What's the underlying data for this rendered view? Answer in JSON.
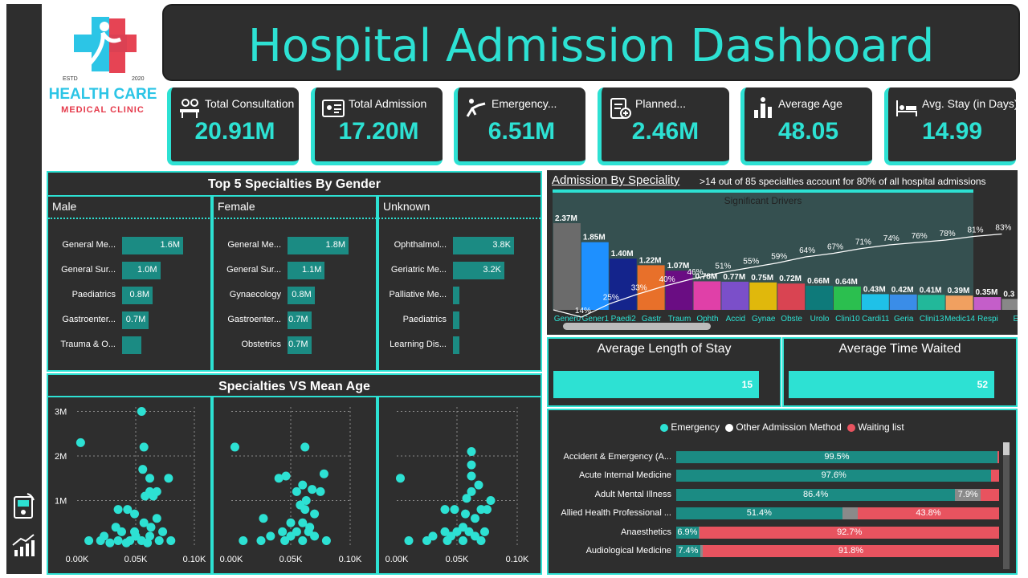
{
  "logo": {
    "estd": "ESTD",
    "year": "2020",
    "name": "HEALTH CARE",
    "sub": "MEDICAL CLINIC"
  },
  "title": "Hospital Admission Dashboard",
  "kpis": [
    {
      "label": "Total Consultation",
      "value": "20.91M",
      "icon": "consultation-icon"
    },
    {
      "label": "Total Admission",
      "value": "17.20M",
      "icon": "id-card-icon"
    },
    {
      "label": "Emergency...",
      "value": "6.51M",
      "icon": "emergency-icon"
    },
    {
      "label": "Planned...",
      "value": "2.46M",
      "icon": "clipboard-icon"
    },
    {
      "label": "Average Age",
      "value": "48.05",
      "icon": "bar-people-icon"
    },
    {
      "label": "Avg. Stay (in Days)",
      "value": "14.99",
      "icon": "bed-icon"
    }
  ],
  "gender_panel": {
    "title": "Top 5 Specialties By Gender",
    "groups": [
      {
        "name": "Male",
        "items": [
          {
            "label": "General Me...",
            "display": "1.6M",
            "value": 1.6
          },
          {
            "label": "General Sur...",
            "display": "1.0M",
            "value": 1.0
          },
          {
            "label": "Paediatrics",
            "display": "0.8M",
            "value": 0.8
          },
          {
            "label": "Gastroenter...",
            "display": "0.7M",
            "value": 0.7
          },
          {
            "label": "Trauma & O...",
            "display": "",
            "value": 0.5
          }
        ]
      },
      {
        "name": "Female",
        "items": [
          {
            "label": "General Me...",
            "display": "1.8M",
            "value": 1.8
          },
          {
            "label": "General Sur...",
            "display": "1.1M",
            "value": 1.1
          },
          {
            "label": "Gynaecology",
            "display": "0.8M",
            "value": 0.8
          },
          {
            "label": "Gastroenter...",
            "display": "0.7M",
            "value": 0.7
          },
          {
            "label": "Obstetrics",
            "display": "0.7M",
            "value": 0.7
          }
        ]
      },
      {
        "name": "Unknown",
        "items": [
          {
            "label": "Ophthalmol...",
            "display": "3.8K",
            "value": 3.8
          },
          {
            "label": "Geriatric Me...",
            "display": "3.2K",
            "value": 3.2
          },
          {
            "label": "Palliative Me...",
            "display": "",
            "value": 0.4
          },
          {
            "label": "Paediatrics",
            "display": "",
            "value": 0.4
          },
          {
            "label": "Learning Dis...",
            "display": "",
            "value": 0.4
          }
        ]
      }
    ]
  },
  "scatter_panel": {
    "title": "Specialties VS Mean Age",
    "y_ticks": [
      "3M",
      "2M",
      "1M"
    ],
    "x_ticks": [
      "0.00K",
      "0.05K",
      "0.10K"
    ]
  },
  "pareto": {
    "title": "Admission By Speciality",
    "note": ">14 out of 85 specialties account for 80% of all hospital admissions",
    "band_label": "Significant Drivers"
  },
  "avg_los": {
    "title": "Average Length of Stay",
    "value": "15",
    "fraction": 1.0
  },
  "avg_wait": {
    "title": "Average Time Waited",
    "value": "52",
    "fraction": 1.0
  },
  "method": {
    "legend": [
      {
        "label": "Emergency",
        "color": "#2de1d3"
      },
      {
        "label": "Other Admission Method",
        "color": "#ffffff"
      },
      {
        "label": "Waiting list",
        "color": "#e8535f"
      }
    ],
    "rows": [
      {
        "label": "Accident & Emergency (A...",
        "emergency": 99.5,
        "other": 0.0,
        "waiting": 0.5,
        "e_lbl": "99.5%",
        "o_lbl": "",
        "w_lbl": ""
      },
      {
        "label": "Acute Internal Medicine",
        "emergency": 97.6,
        "other": 0.0,
        "waiting": 2.4,
        "e_lbl": "97.6%",
        "o_lbl": "",
        "w_lbl": ""
      },
      {
        "label": "Adult Mental Illness",
        "emergency": 86.4,
        "other": 7.9,
        "waiting": 5.7,
        "e_lbl": "86.4%",
        "o_lbl": "7.9%",
        "w_lbl": ""
      },
      {
        "label": "Allied Health Professional ...",
        "emergency": 51.4,
        "other": 4.8,
        "waiting": 43.8,
        "e_lbl": "51.4%",
        "o_lbl": "",
        "w_lbl": "43.8%"
      },
      {
        "label": "Anaesthetics",
        "emergency": 6.9,
        "other": 0.4,
        "waiting": 92.7,
        "e_lbl": "6.9%",
        "o_lbl": "",
        "w_lbl": "92.7%"
      },
      {
        "label": "Audiological Medicine",
        "emergency": 7.4,
        "other": 0.8,
        "waiting": 91.8,
        "e_lbl": "7.4%",
        "o_lbl": "",
        "w_lbl": "91.8%"
      }
    ]
  },
  "chart_data": [
    {
      "type": "bar",
      "title": "Admission By Speciality",
      "categories": [
        "Gener0",
        "Gener1",
        "Paedi2",
        "Gastr",
        "Traum",
        "Ophth",
        "Accid",
        "Gynae",
        "Obste",
        "Urolo",
        "Clini10",
        "Cardi11",
        "Geria",
        "Clini13",
        "Medic14",
        "Respi",
        "E"
      ],
      "values": [
        2.37,
        1.85,
        1.4,
        1.22,
        1.07,
        0.78,
        0.77,
        0.75,
        0.72,
        0.66,
        0.64,
        0.43,
        0.42,
        0.41,
        0.39,
        0.35,
        0.3
      ],
      "value_labels": [
        "2.37M",
        "1.85M",
        "1.40M",
        "1.22M",
        "1.07M",
        "0.78M",
        "0.77M",
        "0.75M",
        "0.72M",
        "0.66M",
        "0.64M",
        "0.43M",
        "0.42M",
        "0.41M",
        "0.39M",
        "0.35M",
        "0.3"
      ],
      "colors": [
        "#6b6b6b",
        "#1e90ff",
        "#14248c",
        "#e8702a",
        "#6a0d83",
        "#e040a8",
        "#7b4fc9",
        "#e0b80c",
        "#d94452",
        "#0e7a7a",
        "#2bbf4f",
        "#1fc1e8",
        "#3a8de8",
        "#22b89a",
        "#f0a060",
        "#c45ec9",
        "#888888"
      ],
      "cumulative_pct": [
        14,
        25,
        33,
        40,
        46,
        51,
        55,
        59,
        64,
        67,
        71,
        74,
        76,
        78,
        81,
        83
      ],
      "cumulative_labels": [
        "14%",
        "25%",
        "33%",
        "40%",
        "46%",
        "51%",
        "55%",
        "59%",
        "64%",
        "67%",
        "71%",
        "74%",
        "76%",
        "78%",
        "81%",
        "83%"
      ]
    },
    {
      "type": "scatter",
      "title": "Specialties VS Mean Age",
      "panels": [
        {
          "name": "Male",
          "points": [
            [
              0.003,
              2.3
            ],
            [
              0.055,
              3.0
            ],
            [
              0.057,
              2.2
            ],
            [
              0.056,
              1.7
            ],
            [
              0.062,
              1.5
            ],
            [
              0.078,
              1.5
            ],
            [
              0.062,
              1.2
            ],
            [
              0.068,
              1.2
            ],
            [
              0.058,
              1.1
            ],
            [
              0.065,
              1.1
            ],
            [
              0.035,
              0.8
            ],
            [
              0.043,
              0.8
            ],
            [
              0.049,
              0.7
            ],
            [
              0.068,
              0.6
            ],
            [
              0.057,
              0.5
            ],
            [
              0.063,
              0.4
            ],
            [
              0.033,
              0.4
            ],
            [
              0.049,
              0.3
            ],
            [
              0.038,
              0.3
            ],
            [
              0.073,
              0.3
            ],
            [
              0.023,
              0.2
            ],
            [
              0.05,
              0.2
            ],
            [
              0.062,
              0.2
            ],
            [
              0.01,
              0.1
            ],
            [
              0.02,
              0.1
            ],
            [
              0.035,
              0.1
            ],
            [
              0.045,
              0.1
            ],
            [
              0.055,
              0.1
            ],
            [
              0.07,
              0.1
            ],
            [
              0.08,
              0.1
            ],
            [
              0.028,
              0.05
            ],
            [
              0.042,
              0.05
            ],
            [
              0.06,
              0.05
            ]
          ]
        },
        {
          "name": "Female",
          "points": [
            [
              0.003,
              2.2
            ],
            [
              0.062,
              2.2
            ],
            [
              0.04,
              1.5
            ],
            [
              0.046,
              1.55
            ],
            [
              0.078,
              1.6
            ],
            [
              0.06,
              1.35
            ],
            [
              0.068,
              1.25
            ],
            [
              0.055,
              1.2
            ],
            [
              0.075,
              1.2
            ],
            [
              0.063,
              1.0
            ],
            [
              0.058,
              0.9
            ],
            [
              0.062,
              0.8
            ],
            [
              0.07,
              0.7
            ],
            [
              0.027,
              0.6
            ],
            [
              0.05,
              0.5
            ],
            [
              0.06,
              0.5
            ],
            [
              0.066,
              0.4
            ],
            [
              0.043,
              0.3
            ],
            [
              0.055,
              0.3
            ],
            [
              0.065,
              0.3
            ],
            [
              0.033,
              0.2
            ],
            [
              0.05,
              0.2
            ],
            [
              0.07,
              0.2
            ],
            [
              0.01,
              0.1
            ],
            [
              0.025,
              0.1
            ],
            [
              0.045,
              0.1
            ],
            [
              0.06,
              0.1
            ],
            [
              0.08,
              0.1
            ]
          ]
        },
        {
          "name": "Unknown",
          "points": [
            [
              0.003,
              1.5
            ],
            [
              0.062,
              2.1
            ],
            [
              0.062,
              1.8
            ],
            [
              0.062,
              1.55
            ],
            [
              0.068,
              1.35
            ],
            [
              0.062,
              1.2
            ],
            [
              0.058,
              1.05
            ],
            [
              0.078,
              1.0
            ],
            [
              0.04,
              0.8
            ],
            [
              0.048,
              0.8
            ],
            [
              0.07,
              0.8
            ],
            [
              0.075,
              0.8
            ],
            [
              0.057,
              0.7
            ],
            [
              0.065,
              0.6
            ],
            [
              0.055,
              0.4
            ],
            [
              0.04,
              0.3
            ],
            [
              0.05,
              0.3
            ],
            [
              0.06,
              0.3
            ],
            [
              0.073,
              0.3
            ],
            [
              0.03,
              0.2
            ],
            [
              0.045,
              0.2
            ],
            [
              0.065,
              0.2
            ],
            [
              0.01,
              0.1
            ],
            [
              0.025,
              0.1
            ],
            [
              0.042,
              0.1
            ],
            [
              0.055,
              0.1
            ],
            [
              0.07,
              0.1
            ]
          ]
        }
      ],
      "xlim": [
        0,
        0.1
      ],
      "ylim": [
        0,
        3.1
      ]
    }
  ]
}
